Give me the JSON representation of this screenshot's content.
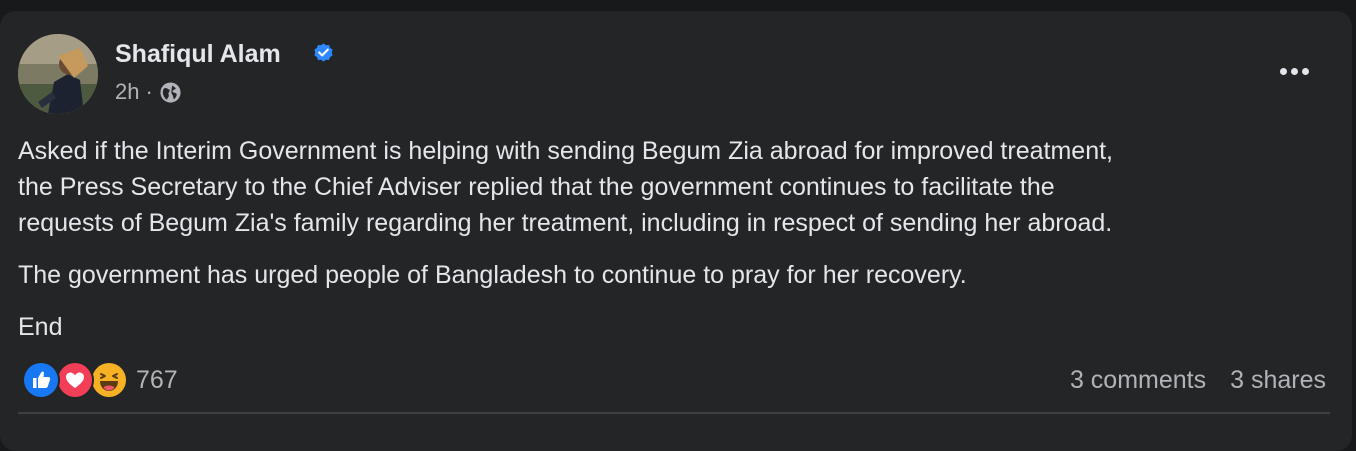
{
  "post": {
    "author": "Shafiqul Alam",
    "verified": true,
    "time": "2h",
    "separator": "·",
    "audience_icon": "globe-icon",
    "paragraphs": [
      "Asked if the Interim Government is helping with sending Begum Zia abroad for improved treatment,",
      "the Press Secretary to the Chief Adviser replied that the government continues to facilitate the",
      "requests of Begum Zia's family regarding her treatment, including in respect of sending her abroad.",
      "The government has urged people of Bangladesh to continue to pray for her recovery.",
      "End"
    ],
    "reactions": {
      "icons": [
        "like-reaction-icon",
        "love-reaction-icon",
        "haha-reaction-icon"
      ],
      "count": "767"
    },
    "comments": "3 comments",
    "shares": "3 shares"
  },
  "colors": {
    "background": "#18191a",
    "card": "#242526",
    "primary_text": "#e4e6eb",
    "secondary_text": "#b0b3b8",
    "verified_badge": "#2d88ff",
    "like": "#1877f2",
    "love": "#f33e58",
    "haha": "#f7b125"
  }
}
